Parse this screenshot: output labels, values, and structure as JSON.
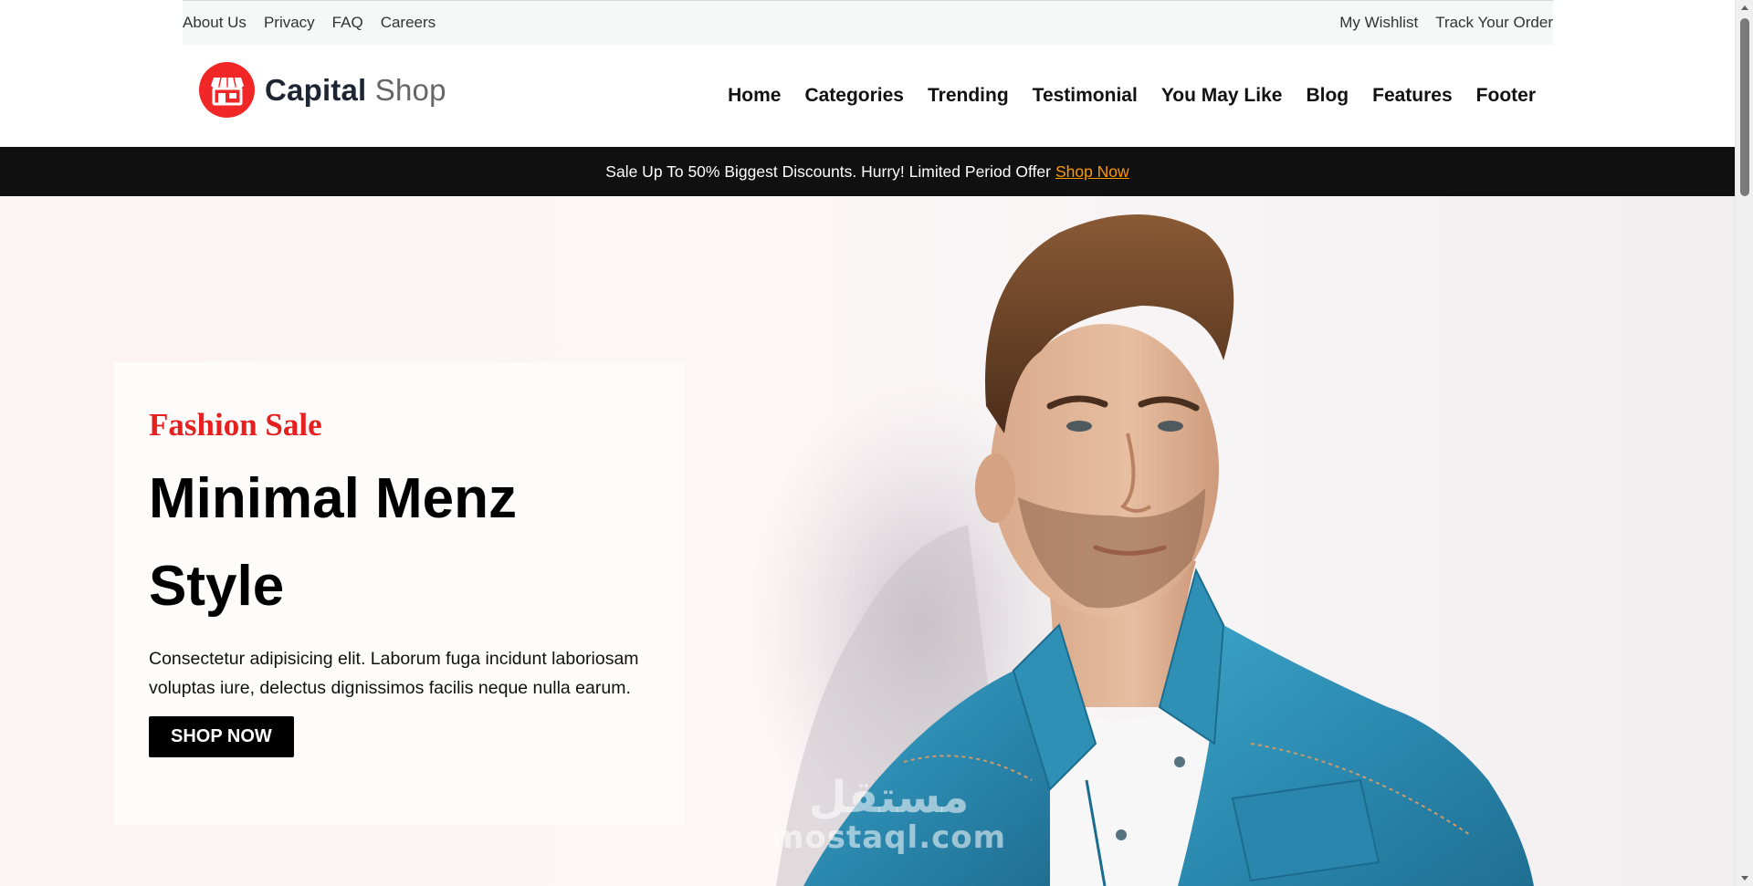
{
  "topbar": {
    "left_links": [
      "About Us",
      "Privacy",
      "FAQ",
      "Careers"
    ],
    "right_links": [
      "My Wishlist",
      "Track Your Order"
    ]
  },
  "header": {
    "logo_bold": "Capital",
    "logo_light": "Shop",
    "nav": [
      "Home",
      "Categories",
      "Trending",
      "Testimonial",
      "You May Like",
      "Blog",
      "Features",
      "Footer"
    ]
  },
  "promo": {
    "text": "Sale Up To 50% Biggest Discounts. Hurry! Limited Period Offer",
    "link": "Shop Now"
  },
  "hero": {
    "eyebrow": "Fashion Sale",
    "headline": "Minimal Menz Style",
    "description": "Consectetur adipisicing elit. Laborum fuga incidunt laboriosam voluptas iure, delectus dignissimos facilis neque nulla earum.",
    "button": "SHOP NOW",
    "image_alt": "man-in-denim-shirt-photo"
  },
  "watermark": {
    "arabic": "مستقل",
    "latin": "mostaql.com"
  },
  "colors": {
    "brand_red": "#f12727",
    "eyebrow_red": "#e61f1f",
    "promo_link": "#ff9a00",
    "promo_bg": "#101010",
    "denim": "#2e8fb4"
  }
}
